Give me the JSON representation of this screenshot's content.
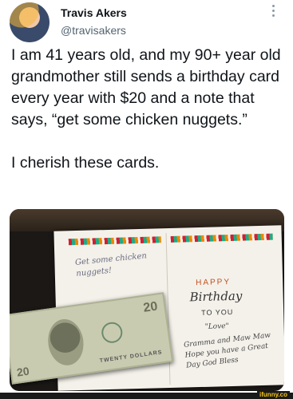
{
  "author": {
    "name": "Travis Akers",
    "handle": "@travisakers"
  },
  "tweet": {
    "text_p1": "I am 41 years old, and my 90+ year old grandmother still sends a birthday card every year with $20 and a note that says, “get some chicken nuggets.”",
    "text_p2": "I cherish these cards."
  },
  "photo": {
    "note": "Get some chicken nuggets!",
    "happy": "HAPPY",
    "birthday": "Birthday",
    "to_you": "TO YOU",
    "love": "\"Love\"",
    "signature": "Gramma and Maw Maw Hope you have a Great Day God Bless",
    "bill_amount": "20",
    "bill_label": "TWENTY DOLLARS"
  },
  "watermark": "ifunny.co",
  "colors": {
    "text": "#0f1419",
    "secondary": "#536471"
  }
}
